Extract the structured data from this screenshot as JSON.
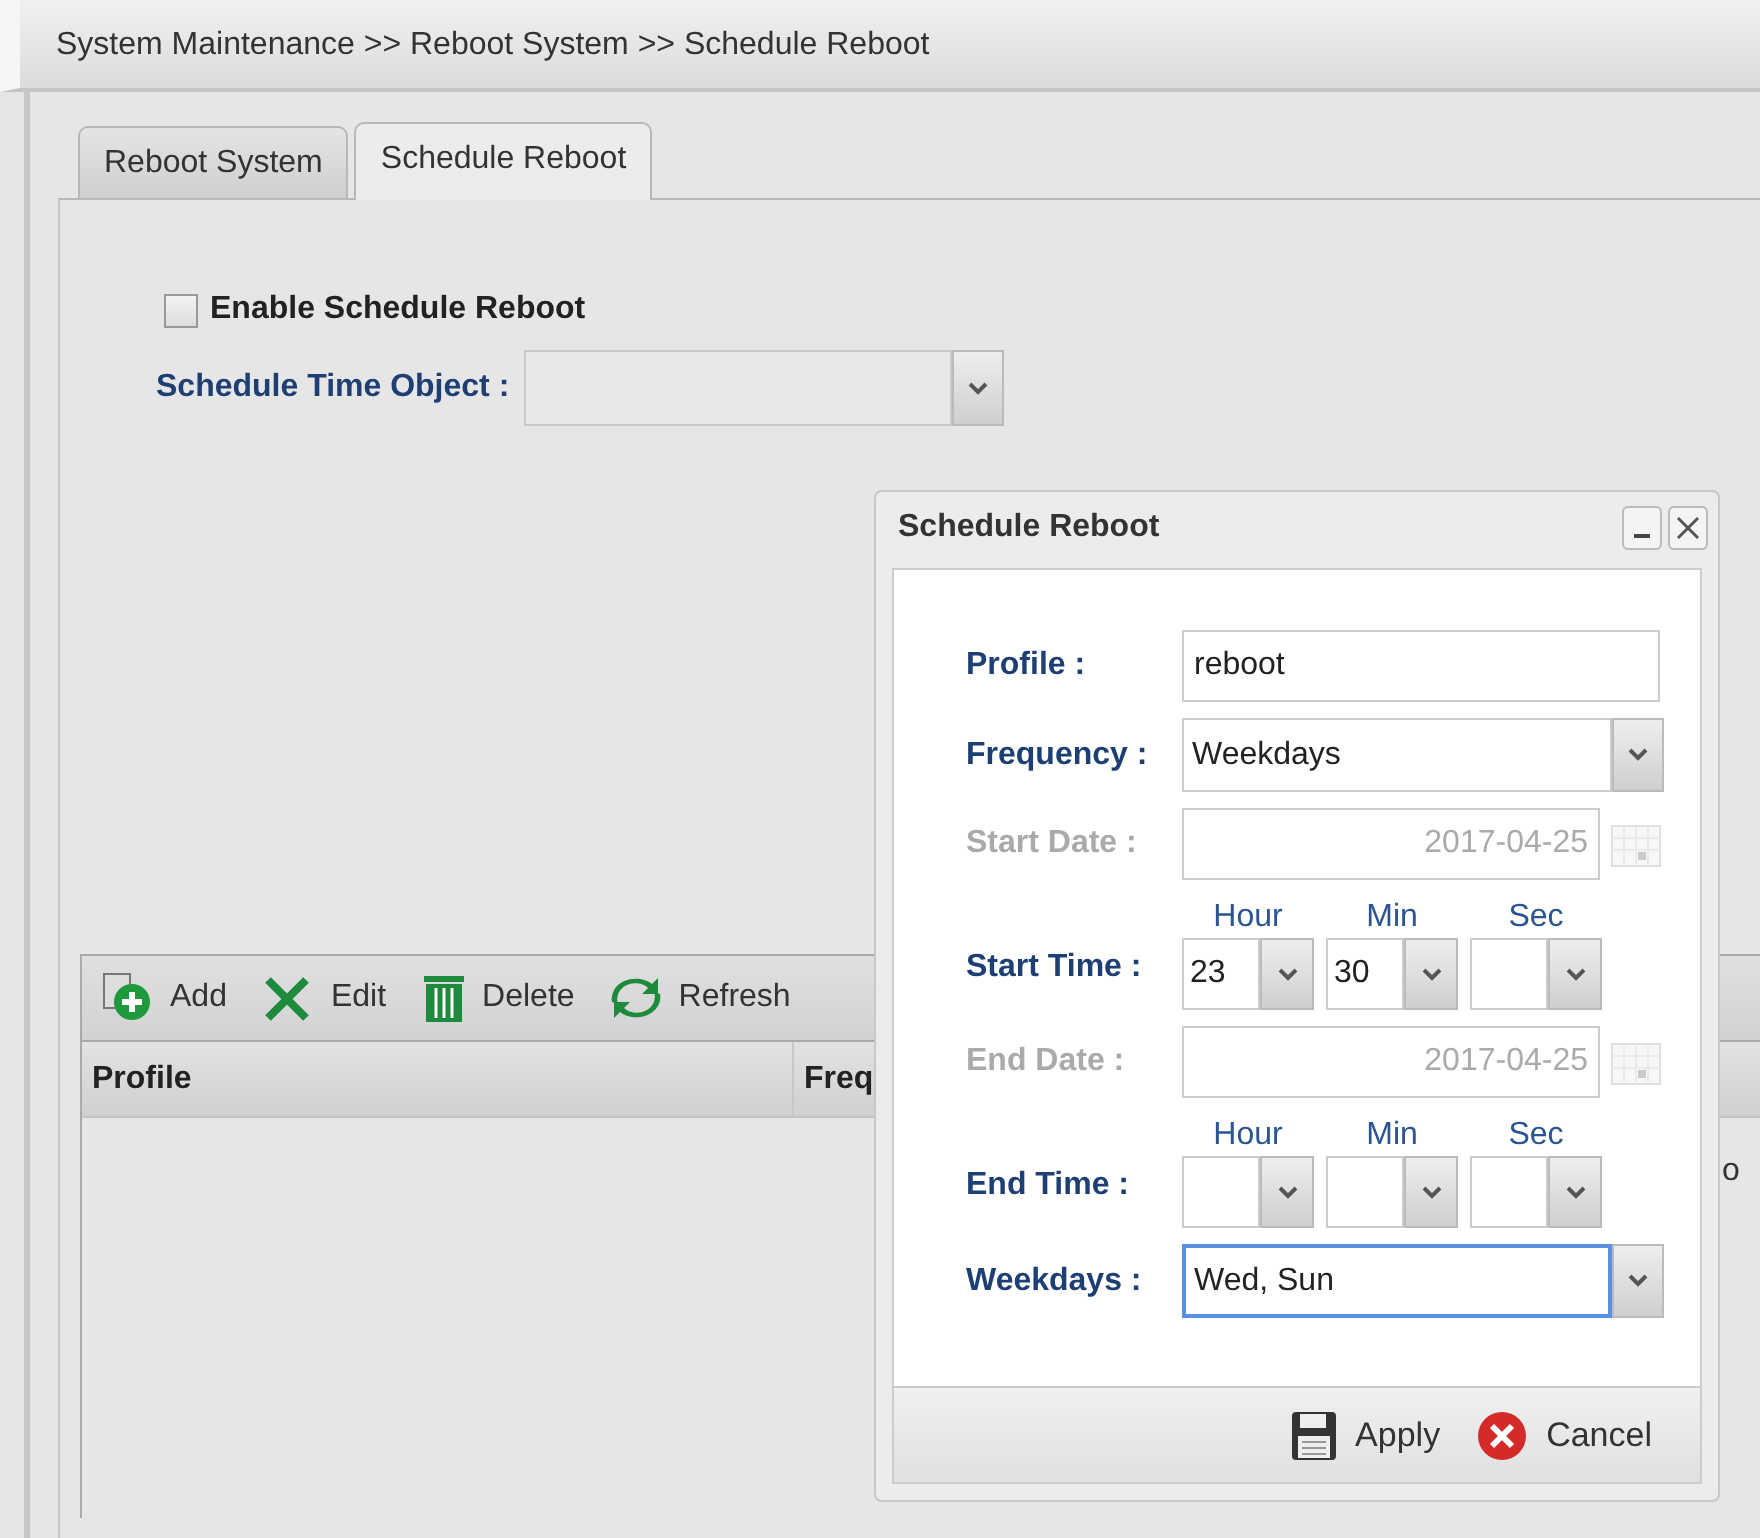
{
  "breadcrumb": "System Maintenance >> Reboot System >> Schedule Reboot",
  "tabs": [
    {
      "label": "Reboot System",
      "selected": false
    },
    {
      "label": "Schedule Reboot",
      "selected": true
    }
  ],
  "enable_schedule_reboot": {
    "label": "Enable Schedule Reboot",
    "checked": false
  },
  "schedule_time_object": {
    "label": "Schedule Time Object :"
  },
  "toolbar": [
    {
      "label": "Add",
      "kind": "add"
    },
    {
      "label": "Edit",
      "kind": "edit"
    },
    {
      "label": "Delete",
      "kind": "delete"
    },
    {
      "label": "Refresh",
      "kind": "refresh"
    }
  ],
  "table": {
    "columns": [
      "Profile",
      "Freq"
    ],
    "fragment": "o"
  },
  "dialog": {
    "title": "Schedule Reboot",
    "fields": [
      {
        "kind": "text",
        "label": "Profile :",
        "value": "reboot"
      },
      {
        "kind": "select",
        "label": "Frequency :",
        "value": "Weekdays",
        "focused": false
      },
      {
        "kind": "date",
        "label": "Start Date :",
        "value": "2017-04-25",
        "disabled": true
      },
      {
        "kind": "time",
        "label": "Start Time :",
        "parts": [
          {
            "caption": "Hour",
            "value": "23"
          },
          {
            "caption": "Min",
            "value": "30"
          },
          {
            "caption": "Sec"
          }
        ]
      },
      {
        "kind": "date",
        "label": "End Date :",
        "value": "2017-04-25",
        "disabled": true
      },
      {
        "kind": "time",
        "label": "End Time :",
        "parts": [
          {
            "caption": "Hour"
          },
          {
            "caption": "Min"
          },
          {
            "caption": "Sec"
          }
        ]
      },
      {
        "kind": "select",
        "label": "Weekdays :",
        "value": "Wed, Sun",
        "focused": true
      }
    ],
    "buttons": [
      {
        "label": "Apply",
        "kind": "apply"
      },
      {
        "label": "Cancel",
        "kind": "cancel"
      }
    ]
  }
}
